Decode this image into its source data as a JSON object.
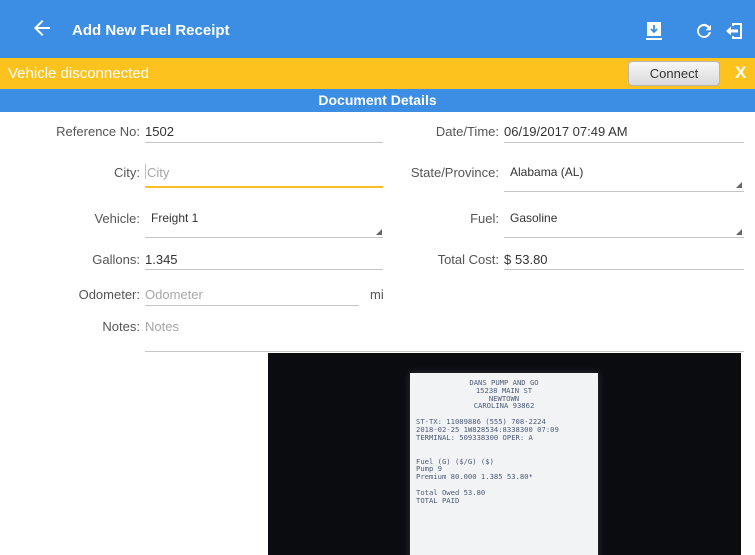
{
  "appbar": {
    "title": "Add New Fuel Receipt",
    "icons": [
      "back-arrow-icon",
      "attach-document-icon",
      "refresh-icon",
      "logout-icon"
    ]
  },
  "alert": {
    "message": "Vehicle disconnected",
    "connect_label": "Connect",
    "close_label": "X"
  },
  "section": {
    "title": "Document Details"
  },
  "form": {
    "reference": {
      "label": "Reference No:",
      "value": "1502"
    },
    "datetime": {
      "label": "Date/Time:",
      "value": "06/19/2017 07:49 AM"
    },
    "city": {
      "label": "City:",
      "placeholder": "City"
    },
    "state": {
      "label": "State/Province:",
      "value": "Alabama (AL)"
    },
    "vehicle": {
      "label": "Vehicle:",
      "value": "Freight 1"
    },
    "fuel": {
      "label": "Fuel:",
      "value": "Gasoline"
    },
    "gallons": {
      "label": "Gallons:",
      "value": "1.345"
    },
    "total_cost": {
      "label": "Total Cost:",
      "currency": "$",
      "value": "53.80"
    },
    "odometer": {
      "label": "Odometer:",
      "placeholder": "Odometer",
      "unit": "mi"
    },
    "notes": {
      "label": "Notes:",
      "placeholder": "Notes"
    }
  },
  "receipt": {
    "lines_header": [
      "DANS PUMP AND GO",
      "15238 MAIN ST",
      "NEWTOWN",
      "CAROLINA 93862"
    ],
    "lines_info": [
      "ST-TX: 11089886      (555) 708-2224",
      "2018-02-25 1W828534:8338300 07:09",
      "TERMINAL: 509338300 OPER: A"
    ],
    "lines_items": [
      "Fuel             (G)   ($/G)    ($)",
      "Pump 9",
      "Premium       80.000  1.385  53.80*"
    ],
    "lines_total": [
      "Total Owed                     53.80",
      "TOTAL PAID"
    ]
  },
  "colors": {
    "primary": "#3c8de4",
    "warning": "#fec21e",
    "accent": "#fbbf23"
  }
}
